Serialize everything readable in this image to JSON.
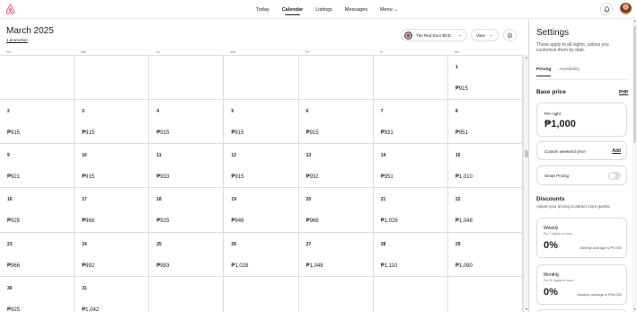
{
  "nav": {
    "items": [
      {
        "label": "Today",
        "active": false
      },
      {
        "label": "Calendar",
        "active": true
      },
      {
        "label": "Listings",
        "active": false
      },
      {
        "label": "Messages",
        "active": false
      },
      {
        "label": "Menu",
        "active": false
      }
    ]
  },
  "calendar": {
    "title": "March 2025",
    "subtitle": "1 promotion",
    "listing_name": "The Red Door BCD",
    "view_label": "View",
    "weekdays": [
      "Su",
      "Mo",
      "Tu",
      "We",
      "Th",
      "Fr",
      "Sa"
    ],
    "weeks": [
      [
        null,
        null,
        null,
        null,
        null,
        null,
        {
          "day": "1",
          "price": "₱915"
        }
      ],
      [
        {
          "day": "2",
          "price": "₱915"
        },
        {
          "day": "3",
          "price": "₱915"
        },
        {
          "day": "4",
          "price": "₱915"
        },
        {
          "day": "5",
          "price": "₱915"
        },
        {
          "day": "6",
          "price": "₱915"
        },
        {
          "day": "7",
          "price": "₱931"
        },
        {
          "day": "8",
          "price": "₱951"
        }
      ],
      [
        {
          "day": "9",
          "price": "₱921"
        },
        {
          "day": "10",
          "price": "₱915"
        },
        {
          "day": "11",
          "price": "₱933"
        },
        {
          "day": "12",
          "price": "₱915"
        },
        {
          "day": "13",
          "price": "₱932"
        },
        {
          "day": "14",
          "price": "₱951"
        },
        {
          "day": "15",
          "price": "₱1,010"
        }
      ],
      [
        {
          "day": "16",
          "price": "₱925"
        },
        {
          "day": "17",
          "price": "₱966"
        },
        {
          "day": "18",
          "price": "₱925"
        },
        {
          "day": "19",
          "price": "₱946"
        },
        {
          "day": "20",
          "price": "₱966"
        },
        {
          "day": "21",
          "price": "₱1,028"
        },
        {
          "day": "22",
          "price": "₱1,048"
        }
      ],
      [
        {
          "day": "23",
          "price": "₱966"
        },
        {
          "day": "24",
          "price": "₱992"
        },
        {
          "day": "25",
          "price": "₱993"
        },
        {
          "day": "26",
          "price": "₱1,028"
        },
        {
          "day": "27",
          "price": "₱1,048"
        },
        {
          "day": "28",
          "price": "₱1,110"
        },
        {
          "day": "29",
          "price": "₱1,090"
        }
      ],
      [
        {
          "day": "30",
          "price": "₱925"
        },
        {
          "day": "31",
          "price": "₱1,042"
        },
        null,
        null,
        null,
        null,
        null
      ]
    ]
  },
  "settings": {
    "title": "Settings",
    "description": "These apply to all nights, unless you customize them by date.",
    "tabs": [
      {
        "label": "Pricing",
        "active": true
      },
      {
        "label": "Availability",
        "active": false
      }
    ],
    "base_price_label": "Base price",
    "currency": "PHP",
    "per_night_label": "Per night",
    "per_night_value": "₱1,000",
    "custom_weekend_label": "Custom weekend price",
    "custom_weekend_action": "Add",
    "smart_pricing_label": "Smart Pricing",
    "smart_pricing_on": false,
    "discounts_title": "Discounts",
    "discounts_desc": "Adjust your pricing to attract more guests.",
    "weekly": {
      "name": "Weekly",
      "sub": "For 7 nights or more",
      "pct": "0%",
      "avg": "Weekly average is ₱7,000"
    },
    "monthly": {
      "name": "Monthly",
      "sub": "For 28 nights or more",
      "pct": "0%",
      "avg": "Monthly average is ₱30,000"
    }
  },
  "colors": {
    "brand": "#ff385c",
    "border": "#dddddd",
    "text": "#222222"
  }
}
